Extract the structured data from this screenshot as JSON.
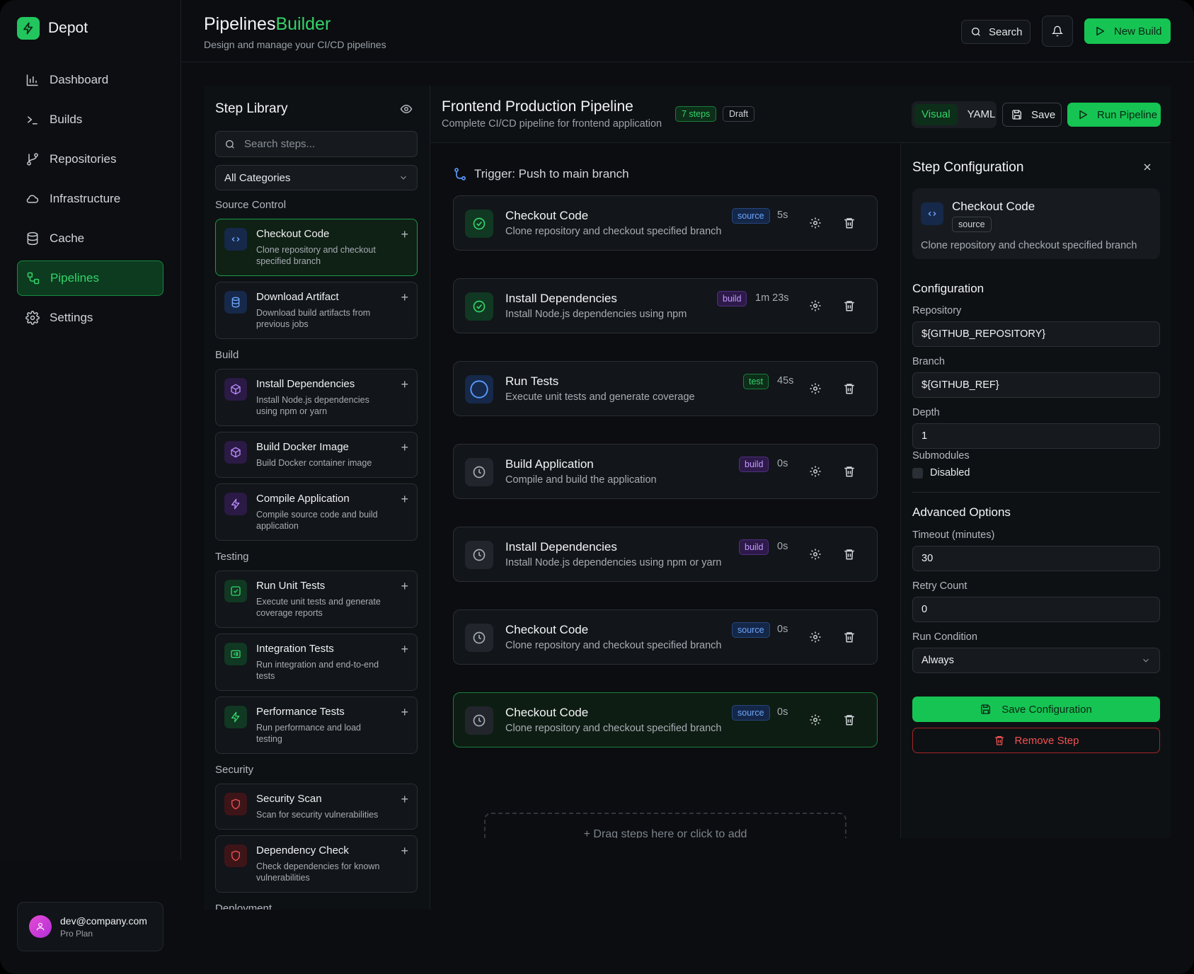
{
  "brand": {
    "name": "Depot"
  },
  "nav": [
    {
      "label": "Dashboard",
      "icon": "bar-chart-icon"
    },
    {
      "label": "Builds",
      "icon": "terminal-icon"
    },
    {
      "label": "Repositories",
      "icon": "git-branch-icon"
    },
    {
      "label": "Infrastructure",
      "icon": "cloud-icon"
    },
    {
      "label": "Cache",
      "icon": "database-icon"
    },
    {
      "label": "Pipelines",
      "icon": "workflow-icon",
      "active": true
    },
    {
      "label": "Settings",
      "icon": "gear-icon"
    }
  ],
  "user": {
    "email": "dev@company.com",
    "plan": "Pro Plan"
  },
  "header": {
    "title": "Pipelines",
    "title_accent": "Builder",
    "subtitle": "Design and manage your CI/CD pipelines",
    "search_label": "Search",
    "new_build_label": "New Build"
  },
  "library": {
    "title": "Step Library",
    "search_placeholder": "Search steps...",
    "category_select": "All Categories",
    "categories": [
      {
        "name": "Source Control",
        "items": [
          {
            "name": "Checkout Code",
            "desc": "Clone repository and checkout specified branch",
            "icon": "code-icon",
            "color": "blue",
            "selected": true
          },
          {
            "name": "Download Artifact",
            "desc": "Download build artifacts from previous jobs",
            "icon": "database-icon",
            "color": "blue"
          }
        ]
      },
      {
        "name": "Build",
        "items": [
          {
            "name": "Install Dependencies",
            "desc": "Install Node.js dependencies using npm or yarn",
            "icon": "package-icon",
            "color": "purple"
          },
          {
            "name": "Build Docker Image",
            "desc": "Build Docker container image",
            "icon": "package-icon",
            "color": "purple"
          },
          {
            "name": "Compile Application",
            "desc": "Compile source code and build application",
            "icon": "bolt-icon",
            "color": "purple"
          }
        ]
      },
      {
        "name": "Testing",
        "items": [
          {
            "name": "Run Unit Tests",
            "desc": "Execute unit tests and generate coverage reports",
            "icon": "check-square-icon",
            "color": "green"
          },
          {
            "name": "Integration Tests",
            "desc": "Run integration and end-to-end tests",
            "icon": "test-icon",
            "color": "green"
          },
          {
            "name": "Performance Tests",
            "desc": "Run performance and load testing",
            "icon": "bolt-icon",
            "color": "green"
          }
        ]
      },
      {
        "name": "Security",
        "items": [
          {
            "name": "Security Scan",
            "desc": "Scan for security vulnerabilities",
            "icon": "shield-icon",
            "color": "red"
          },
          {
            "name": "Dependency Check",
            "desc": "Check dependencies for known vulnerabilities",
            "icon": "shield-icon",
            "color": "red"
          }
        ]
      },
      {
        "name": "Deployment",
        "items": []
      }
    ]
  },
  "pipeline": {
    "title": "Frontend Production Pipeline",
    "subtitle": "Complete CI/CD pipeline for frontend application",
    "steps_badge": "7 steps",
    "status_badge": "Draft",
    "view_visual": "Visual",
    "view_yaml": "YAML",
    "save_label": "Save",
    "run_label": "Run Pipeline",
    "trigger": "Trigger: Push to main branch",
    "drop_hint": "Drag steps here or click to add",
    "steps": [
      {
        "name": "Checkout Code",
        "desc": "Clone repository and checkout specified branch",
        "tag": "source",
        "time": "5s",
        "status": "done"
      },
      {
        "name": "Install Dependencies",
        "desc": "Install Node.js dependencies using npm",
        "tag": "build",
        "time": "1m 23s",
        "status": "done"
      },
      {
        "name": "Run Tests",
        "desc": "Execute unit tests and generate coverage",
        "tag": "test",
        "time": "45s",
        "status": "running"
      },
      {
        "name": "Build Application",
        "desc": "Compile and build the application",
        "tag": "build",
        "time": "0s",
        "status": "pending"
      },
      {
        "name": "Install Dependencies",
        "desc": "Install Node.js dependencies using npm or yarn",
        "tag": "build",
        "time": "0s",
        "status": "pending"
      },
      {
        "name": "Checkout Code",
        "desc": "Clone repository and checkout specified branch",
        "tag": "source",
        "time": "0s",
        "status": "pending"
      },
      {
        "name": "Checkout Code",
        "desc": "Clone repository and checkout specified branch",
        "tag": "source",
        "time": "0s",
        "status": "pending",
        "active": true
      }
    ]
  },
  "config": {
    "title": "Step Configuration",
    "step_name": "Checkout Code",
    "step_tag": "source",
    "step_desc": "Clone repository and checkout specified branch",
    "section_config": "Configuration",
    "repository_label": "Repository",
    "repository_value": "${GITHUB_REPOSITORY}",
    "branch_label": "Branch",
    "branch_value": "${GITHUB_REF}",
    "depth_label": "Depth",
    "depth_value": "1",
    "submodules_label": "Submodules",
    "submodules_value": "Disabled",
    "section_advanced": "Advanced Options",
    "timeout_label": "Timeout (minutes)",
    "timeout_value": "30",
    "retry_label": "Retry Count",
    "retry_value": "0",
    "condition_label": "Run Condition",
    "condition_value": "Always",
    "save_label": "Save Configuration",
    "remove_label": "Remove Step"
  },
  "colors": {
    "accent": "#22c55e",
    "background": "#0b0d10",
    "panel": "#0e1114",
    "danger": "#f05252"
  }
}
